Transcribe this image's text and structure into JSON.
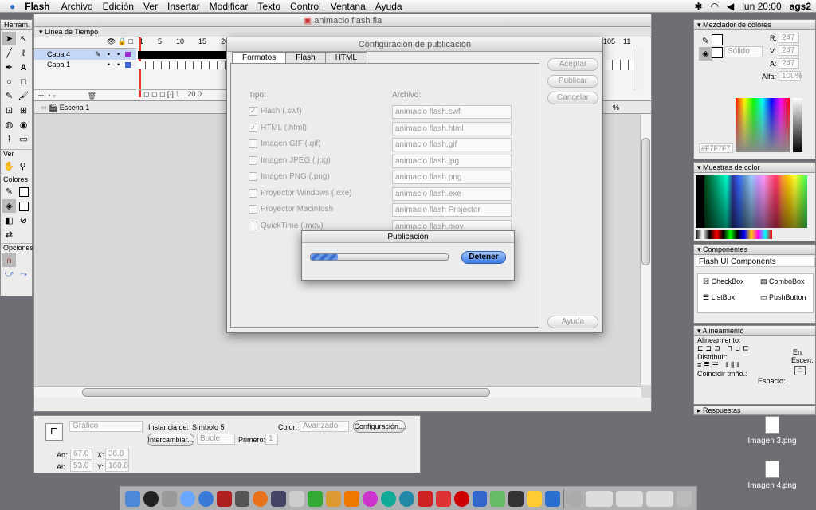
{
  "menubar": {
    "apple": "",
    "app": "Flash",
    "items": [
      "Archivo",
      "Edición",
      "Ver",
      "Insertar",
      "Modificar",
      "Texto",
      "Control",
      "Ventana",
      "Ayuda"
    ],
    "clock": "lun 20:00",
    "user": "ags2"
  },
  "main_window": {
    "title": "animacio flash.fla",
    "timeline_label": "Línea de Tiempo",
    "layers": [
      "Capa 4",
      "Capa 1"
    ],
    "frame_numbers": [
      "1",
      "5",
      "10",
      "15",
      "20"
    ],
    "frame_numbers_right": [
      "105",
      "11"
    ],
    "fps": "20.0",
    "scene": "Escena 1",
    "zoom": "%"
  },
  "tools": {
    "title": "Herram.",
    "sections": [
      "Ver",
      "Colores",
      "Opciones"
    ]
  },
  "dialog": {
    "title": "Configuración de publicación",
    "tabs": [
      "Formatos",
      "Flash",
      "HTML"
    ],
    "tipo_label": "Tipo:",
    "archivo_label": "Archivo:",
    "rows": [
      {
        "label": "Flash  (.swf)",
        "file": "animacio flash.swf",
        "checked": "✓"
      },
      {
        "label": "HTML  (.html)",
        "file": "animacio flash.html",
        "checked": "✓"
      },
      {
        "label": "Imagen GIF (.gif)",
        "file": "animacio flash.gif",
        "checked": ""
      },
      {
        "label": "Imagen JPEG (.jpg)",
        "file": "animacio flash.jpg",
        "checked": ""
      },
      {
        "label": "Imagen PNG (.png)",
        "file": "animacio flash.png",
        "checked": ""
      },
      {
        "label": "Proyector Windows (.exe)",
        "file": "animacio flash.exe",
        "checked": ""
      },
      {
        "label": "Proyector Macintosh",
        "file": "animacio flash Projector",
        "checked": ""
      },
      {
        "label": "QuickTime (.mov)",
        "file": "animacio flash.mov",
        "checked": ""
      }
    ],
    "buttons": {
      "accept": "Aceptar",
      "publish": "Publicar",
      "cancel": "Cancelar",
      "help": "Ayuda"
    }
  },
  "progress": {
    "title": "Publicación",
    "stop": "Detener",
    "fraction": 0.2
  },
  "properties": {
    "type": "Gráfico",
    "instance_label": "Instancia de:",
    "instance_value": "Símbolo 5",
    "color_label": "Color:",
    "color_value": "Avanzado",
    "config_button": "Configuración...",
    "swap_button": "Intercambiar...",
    "loop_value": "Bucle",
    "first_label": "Primero:",
    "first_value": "1",
    "w_label": "An:",
    "w_value": "67.0",
    "x_label": "X:",
    "x_value": "36.8",
    "h_label": "Al:",
    "h_value": "53.0",
    "y_label": "Y:",
    "y_value": "160.8"
  },
  "mixer": {
    "title": "Mezclador de colores",
    "r_label": "R:",
    "r": "247",
    "g_label": "V:",
    "g": "247",
    "b_label": "A:",
    "b": "247",
    "alpha_label": "Alfa:",
    "alpha": "100%",
    "fill_style": "Sólido",
    "hex": "#F7F7F7"
  },
  "swatches": {
    "title": "Muestras de color"
  },
  "components": {
    "title": "Componentes",
    "set": "Flash UI Components",
    "items": [
      "CheckBox",
      "ComboBox",
      "ListBox",
      "PushButton"
    ]
  },
  "align": {
    "title": "Alineamiento",
    "align_label": "Alineamiento:",
    "distribute_label": "Distribuir:",
    "match_label": "Coincidir tmño.:",
    "space_label": "Espacio:",
    "to_label": "En",
    "stage_label": "Escen.:"
  },
  "answers": {
    "title": "Respuestas"
  },
  "desktop": {
    "icons": [
      "Imagen 3.png",
      "Imagen 4.png"
    ]
  },
  "colors": {
    "accent": "#3b7be0",
    "stage": "#ffffff",
    "timeline_sel": "#c6d7f5"
  }
}
